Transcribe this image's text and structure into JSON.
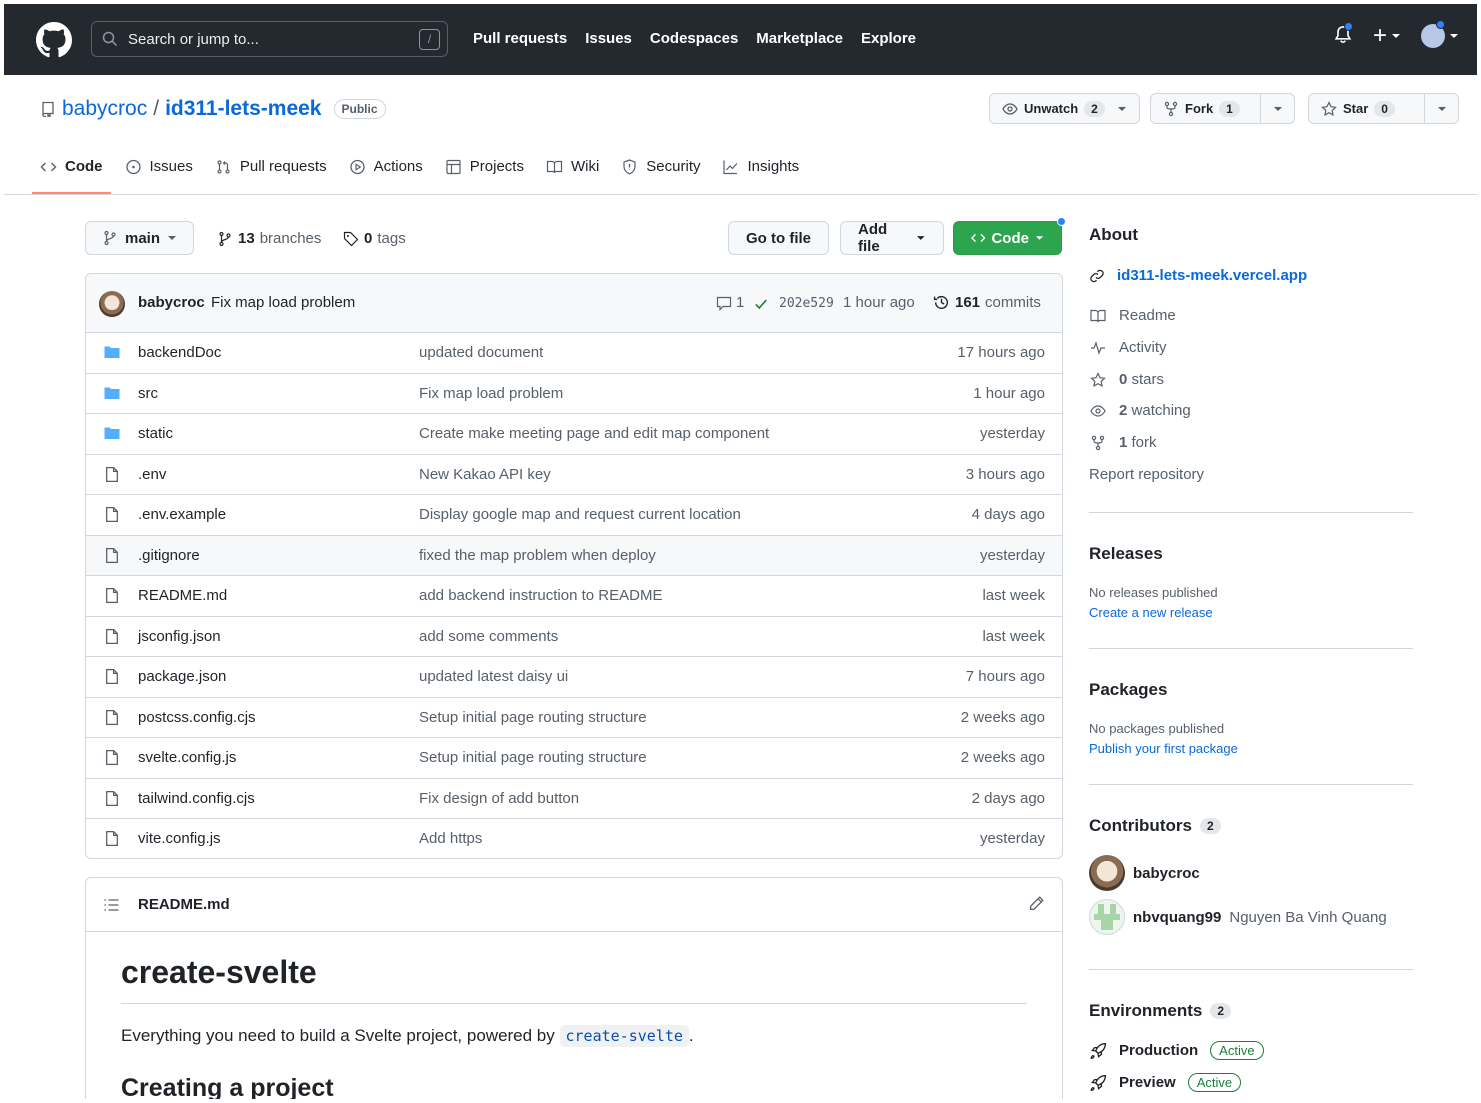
{
  "header": {
    "search_placeholder": "Search or jump to...",
    "search_shortcut": "/",
    "nav": [
      "Pull requests",
      "Issues",
      "Codespaces",
      "Marketplace",
      "Explore"
    ],
    "plus_label": "+"
  },
  "repo": {
    "owner": "babycroc",
    "separator": "/",
    "name": "id311-lets-meek",
    "visibility": "Public",
    "unwatch_label": "Unwatch",
    "watch_count": "2",
    "fork_label": "Fork",
    "fork_count": "1",
    "star_label": "Star",
    "star_count": "0"
  },
  "tabs": [
    {
      "label": "Code",
      "icon": "code-icon",
      "active": true
    },
    {
      "label": "Issues",
      "icon": "issue-icon"
    },
    {
      "label": "Pull requests",
      "icon": "pull-request-icon"
    },
    {
      "label": "Actions",
      "icon": "play-icon"
    },
    {
      "label": "Projects",
      "icon": "table-icon"
    },
    {
      "label": "Wiki",
      "icon": "book-icon"
    },
    {
      "label": "Security",
      "icon": "shield-icon"
    },
    {
      "label": "Insights",
      "icon": "graph-icon"
    }
  ],
  "branchbar": {
    "branch": "main",
    "branches_count": "13",
    "branches_label": "branches",
    "tags_count": "0",
    "tags_label": "tags",
    "go_to_file": "Go to file",
    "add_file": "Add file",
    "code": "Code"
  },
  "commit": {
    "author": "babycroc",
    "message": "Fix map load problem",
    "comments": "1",
    "sha": "202e529",
    "time": "1 hour ago",
    "commits_count": "161",
    "commits_label": "commits"
  },
  "files": [
    {
      "name": "backendDoc",
      "type": "dir",
      "message": "updated document",
      "age": "17 hours ago"
    },
    {
      "name": "src",
      "type": "dir",
      "message": "Fix map load problem",
      "age": "1 hour ago"
    },
    {
      "name": "static",
      "type": "dir",
      "message": "Create make meeting page and edit map component",
      "age": "yesterday"
    },
    {
      "name": ".env",
      "type": "file",
      "message": "New Kakao API key",
      "age": "3 hours ago"
    },
    {
      "name": ".env.example",
      "type": "file",
      "message": "Display google map and request current location",
      "age": "4 days ago"
    },
    {
      "name": ".gitignore",
      "type": "file",
      "message": "fixed the map problem when deploy",
      "age": "yesterday"
    },
    {
      "name": "README.md",
      "type": "file",
      "message": "add backend instruction to README",
      "age": "last week"
    },
    {
      "name": "jsconfig.json",
      "type": "file",
      "message": "add some comments",
      "age": "last week"
    },
    {
      "name": "package.json",
      "type": "file",
      "message": "updated latest daisy ui",
      "age": "7 hours ago"
    },
    {
      "name": "postcss.config.cjs",
      "type": "file",
      "message": "Setup initial page routing structure",
      "age": "2 weeks ago"
    },
    {
      "name": "svelte.config.js",
      "type": "file",
      "message": "Setup initial page routing structure",
      "age": "2 weeks ago"
    },
    {
      "name": "tailwind.config.cjs",
      "type": "file",
      "message": "Fix design of add button",
      "age": "2 days ago"
    },
    {
      "name": "vite.config.js",
      "type": "file",
      "message": "Add https",
      "age": "yesterday"
    }
  ],
  "readme": {
    "filename": "README.md",
    "h1": "create-svelte",
    "intro": "Everything you need to build a Svelte project, powered by",
    "intro_code": "create-svelte",
    "intro_end": ".",
    "h2": "Creating a project"
  },
  "about": {
    "title": "About",
    "website": "id311-lets-meek.vercel.app",
    "readme": "Readme",
    "activity": "Activity",
    "stars_count": "0",
    "stars_label": "stars",
    "watching_count": "2",
    "watching_label": "watching",
    "fork_count": "1",
    "fork_label": "fork",
    "report": "Report repository"
  },
  "releases": {
    "title": "Releases",
    "empty": "No releases published",
    "link": "Create a new release"
  },
  "packages": {
    "title": "Packages",
    "empty": "No packages published",
    "link": "Publish your first package"
  },
  "contributors": {
    "title": "Contributors",
    "count": "2",
    "list": [
      {
        "login": "babycroc",
        "name": ""
      },
      {
        "login": "nbvquang99",
        "name": "Nguyen Ba Vinh Quang"
      }
    ]
  },
  "environments": {
    "title": "Environments",
    "count": "2",
    "list": [
      {
        "name": "Production",
        "status": "Active"
      },
      {
        "name": "Preview",
        "status": "Active"
      }
    ]
  },
  "colors": {
    "header_bg": "#24292f",
    "link": "#0969da",
    "green": "#2da44e",
    "tab_underline": "#fd8c73",
    "folder": "#54aeff"
  }
}
